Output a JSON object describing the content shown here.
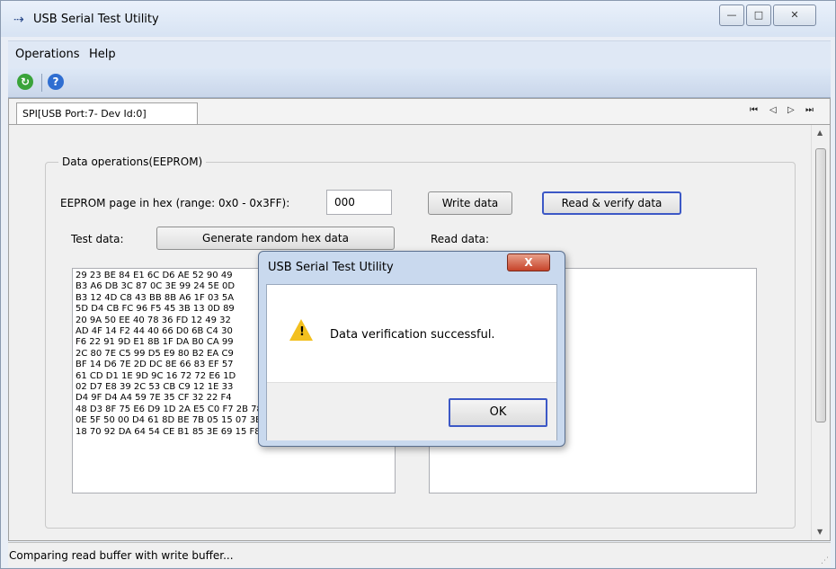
{
  "window": {
    "title": "USB Serial Test Utility",
    "controls": {
      "minimize": "—",
      "maximize": "□",
      "close": "✕"
    }
  },
  "menu": {
    "items": [
      "Operations",
      "Help"
    ]
  },
  "toolbar": {
    "icons": [
      "refresh-icon",
      "help-icon"
    ]
  },
  "tab": {
    "label": "SPI[USB Port:7- Dev Id:0]",
    "nav": [
      "⏮",
      "◁",
      "▷",
      "⏭"
    ]
  },
  "group": {
    "legend": "Data operations(EEPROM)",
    "page_label": "EEPROM page in hex (range: 0x0 - 0x3FF):",
    "page_value": "000",
    "write_button": "Write data",
    "read_verify_button": "Read & verify data",
    "test_data_label": "Test data:",
    "generate_button": "Generate random hex data",
    "read_data_label": "Read data:",
    "test_data_lines": [
      "29 23 BE 84 E1 6C D6 AE 52 90 49",
      "B3 A6 DB 3C 87 0C 3E 99 24 5E 0D",
      "B3 12 4D C8 43 BB 8B A6 1F 03 5A",
      "5D D4 CB FC 96 F5 45 3B 13 0D 89",
      "20 9A 50 EE 40 78 36 FD 12 49 32",
      "AD 4F 14 F2 44 40 66 D0 6B C4 30",
      "F6 22 91 9D E1 8B 1F DA B0 CA 99",
      "2C 80 7E C5 99 D5 E9 80 B2 EA C9",
      "BF 14 D6 7E 2D DC 8E 66 83 EF 57",
      "61 CD D1 1E 9D 9C 16 72 72 E6 1D",
      "02 D7 E8 39 2C 53 CB C9 12 1E 33",
      "D4 9F D4 A4 59 7E 35 CF 32 22 F4",
      "48 D3 8F 75 E6 D9 1D 2A E5 C0 F7 2B 78 81 87 44",
      "0E 5F 50 00 D4 61 8D BE 7B 05 15 07 3B 33 82 1F",
      "18 70 92 DA 64 54 CE B1 85 3E 69 15 F8 46 6A 04"
    ]
  },
  "status": {
    "text": "Comparing read buffer with write buffer..."
  },
  "dialog": {
    "title": "USB Serial Test Utility",
    "close": "X",
    "message": "Data verification successful.",
    "ok": "OK"
  },
  "colors": {
    "focus_border": "#3c58c6",
    "warning": "#f3c01f",
    "close_red": "#c6432a"
  }
}
